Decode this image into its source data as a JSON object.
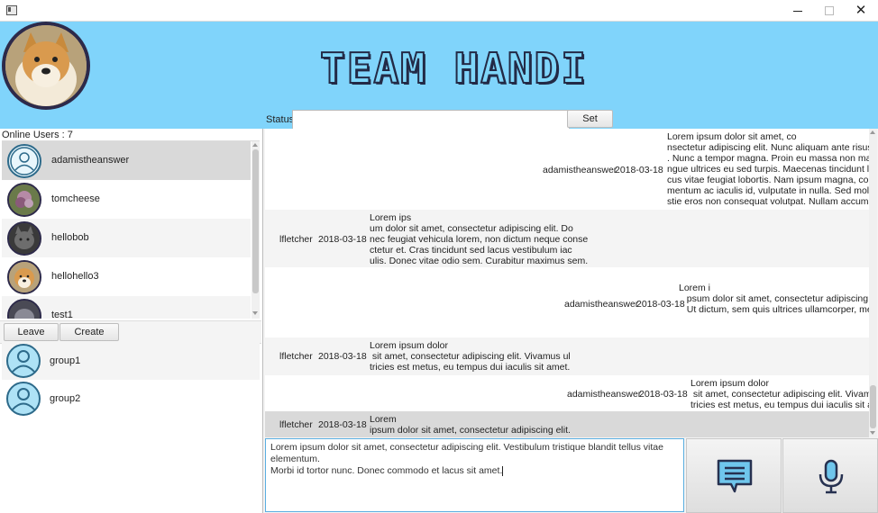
{
  "window": {
    "title": "",
    "min_label": "—",
    "close_label": "✕"
  },
  "header": {
    "logo_text": "TEAM HANDI",
    "bg_color": "#80d4fb"
  },
  "status": {
    "label": "Status:",
    "value": "",
    "button_label": "Set Status"
  },
  "online": {
    "label": "Online Users :  7"
  },
  "users": [
    {
      "name": "adamistheanswer",
      "avatar": "default-user-icon",
      "selected": true
    },
    {
      "name": "tomcheese",
      "avatar": "flower-photo"
    },
    {
      "name": "hellobob",
      "avatar": "cat-photo"
    },
    {
      "name": "hellohello3",
      "avatar": "doge-photo"
    },
    {
      "name": "test1",
      "avatar": "cat-photo"
    }
  ],
  "groups_toolbar": {
    "leave_label": "Leave Group",
    "create_label": "Create Group"
  },
  "groups": [
    {
      "name": "group1",
      "avatar": "default-user-icon"
    },
    {
      "name": "group2",
      "avatar": "default-user-icon"
    }
  ],
  "messages": [
    {
      "sender": "adamistheanswer",
      "date": "2018-03-18",
      "text": "Lorem ipsum dolor sit amet, co\nnsectetur adipiscing elit. Nunc aliquam ante risus\n. Nunc a tempor magna. Proin eu massa non massa co\nngue ultrices eu sed turpis. Maecenas tincidunt la\ncus vitae feugiat lobortis. Nam ipsum magna, condi\nmentum ac iaculis id, vulputate in nulla. Sed mole\nstie eros non consequat volutpat. Nullam accumsan."
    },
    {
      "sender": "lfletcher",
      "date": "2018-03-18",
      "text": "Lorem ips\num dolor sit amet, consectetur adipiscing elit. Do\nnec feugiat vehicula lorem, non dictum neque conse\nctetur et. Cras tincidunt sed lacus vestibulum iac\nulis. Donec vitae odio sem. Curabitur maximus sem."
    },
    {
      "sender": "adamistheanswer",
      "date": "2018-03-18",
      "text": "Lorem i\n   psum dolor sit amet, consectetur adipiscing elit.\n   Ut dictum, sem quis ultrices ullamcorper, metus."
    },
    {
      "sender": "lfletcher",
      "date": "2018-03-18",
      "text": "Lorem ipsum dolor\n sit amet, consectetur adipiscing elit. Vivamus ul\ntricies est metus, eu tempus dui iaculis sit amet."
    },
    {
      "sender": "adamistheanswer",
      "date": "2018-03-18",
      "text": "Lorem ipsum dolor\n sit amet, consectetur adipiscing elit. Vivamus ul\ntricies est metus, eu tempus dui iaculis sit amet."
    },
    {
      "sender": "lfletcher",
      "date": "2018-03-18",
      "text": "Lorem\nipsum dolor sit amet, consectetur adipiscing elit."
    }
  ],
  "compose": {
    "text": "Lorem ipsum dolor sit amet, consectetur adipiscing elit. Vestibulum tristique blandit tellus vitae elementum.\nMorbi id tortor nunc. Donec commodo et lacus sit amet."
  },
  "actions": {
    "send_icon": "message-icon",
    "voice_icon": "microphone-icon"
  }
}
